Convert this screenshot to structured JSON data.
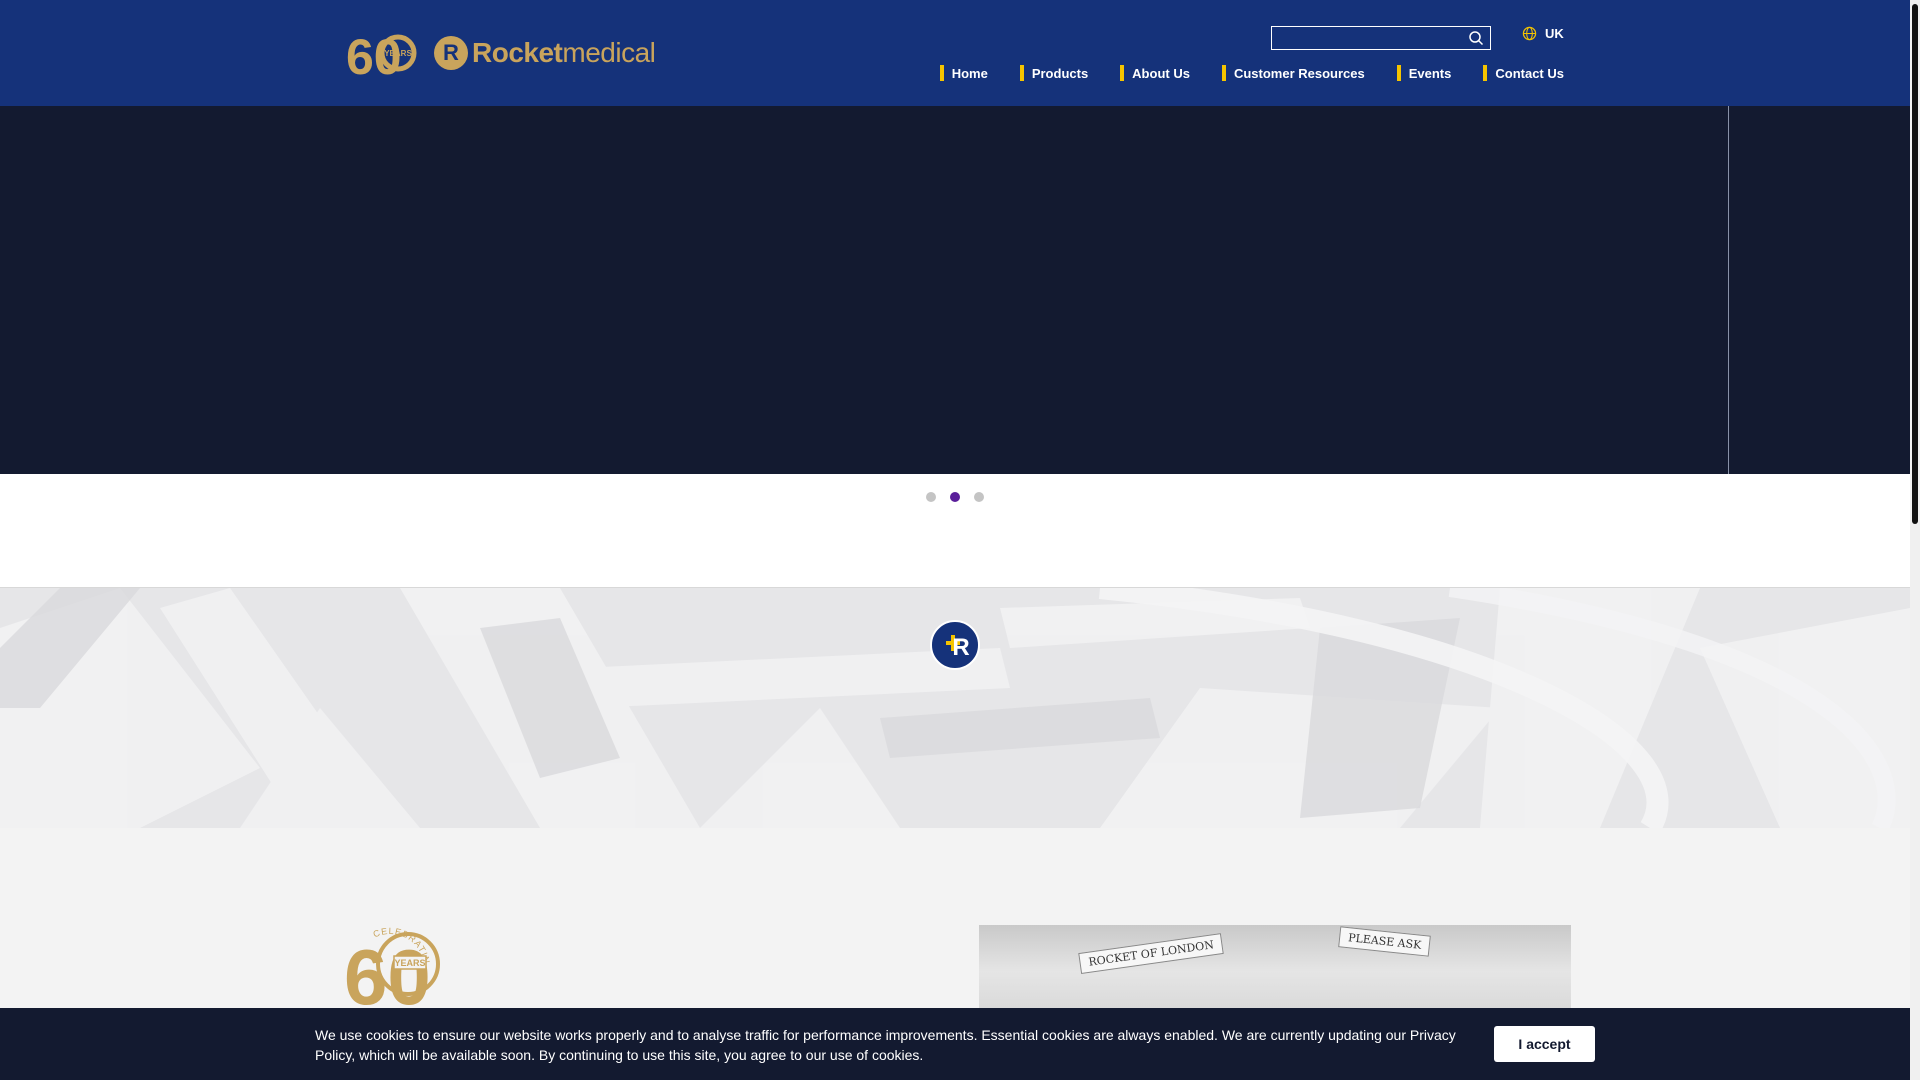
{
  "header": {
    "logo": {
      "anniversary_number": "60",
      "anniversary_label": "YEARS",
      "brand_bold": "Rocket",
      "brand_light": "medical",
      "brand_mark": "R"
    },
    "search": {
      "value": "",
      "placeholder": ""
    },
    "locale": {
      "label": "UK",
      "icon": "globe-icon"
    },
    "nav": [
      {
        "label": "Home"
      },
      {
        "label": "Products"
      },
      {
        "label": "About Us"
      },
      {
        "label": "Customer Resources"
      },
      {
        "label": "Events"
      },
      {
        "label": "Contact Us"
      }
    ]
  },
  "hero": {
    "slide_count": 3,
    "active_slide": 2
  },
  "center_badge": {
    "mark": "R"
  },
  "celebrating_badge": {
    "number": "60",
    "arc_text": "CELEBRATING",
    "label": "YEARS"
  },
  "photo": {
    "signs": [
      "ROCKET OF LONDON",
      "PLEASE ASK"
    ]
  },
  "cookie": {
    "text": "We use cookies to ensure our website works properly and to analyse traffic for performance improvements. Essential cookies are always enabled. We are currently updating our Privacy Policy, which will be available soon. By continuing to use this site, you agree to our use of cookies.",
    "accept_label": "I accept"
  },
  "colors": {
    "header_bg": "#15327a",
    "nav_accent": "#f5c400",
    "gold": "#c9a45c",
    "hero_bg": "#131a30",
    "active_dot": "#5a1e9a"
  }
}
